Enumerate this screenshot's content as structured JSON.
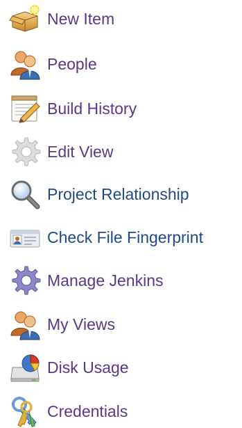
{
  "tasks": [
    {
      "label": "New Item",
      "icon": "new-item-folder-icon"
    },
    {
      "label": "People",
      "icon": "people-icon"
    },
    {
      "label": "Build History",
      "icon": "build-history-notepad-icon"
    },
    {
      "label": "Edit View",
      "icon": "gear-icon"
    },
    {
      "label": "Project Relationship",
      "icon": "magnifier-icon"
    },
    {
      "label": "Check File Fingerprint",
      "icon": "fingerprint-card-icon"
    },
    {
      "label": "Manage Jenkins",
      "icon": "gear-icon"
    },
    {
      "label": "My Views",
      "icon": "people-icon"
    },
    {
      "label": "Disk Usage",
      "icon": "disk-usage-icon"
    },
    {
      "label": "Credentials",
      "icon": "credentials-keys-icon"
    }
  ],
  "colors": {
    "link_visited": "#5a3787",
    "link": "#204a87"
  }
}
